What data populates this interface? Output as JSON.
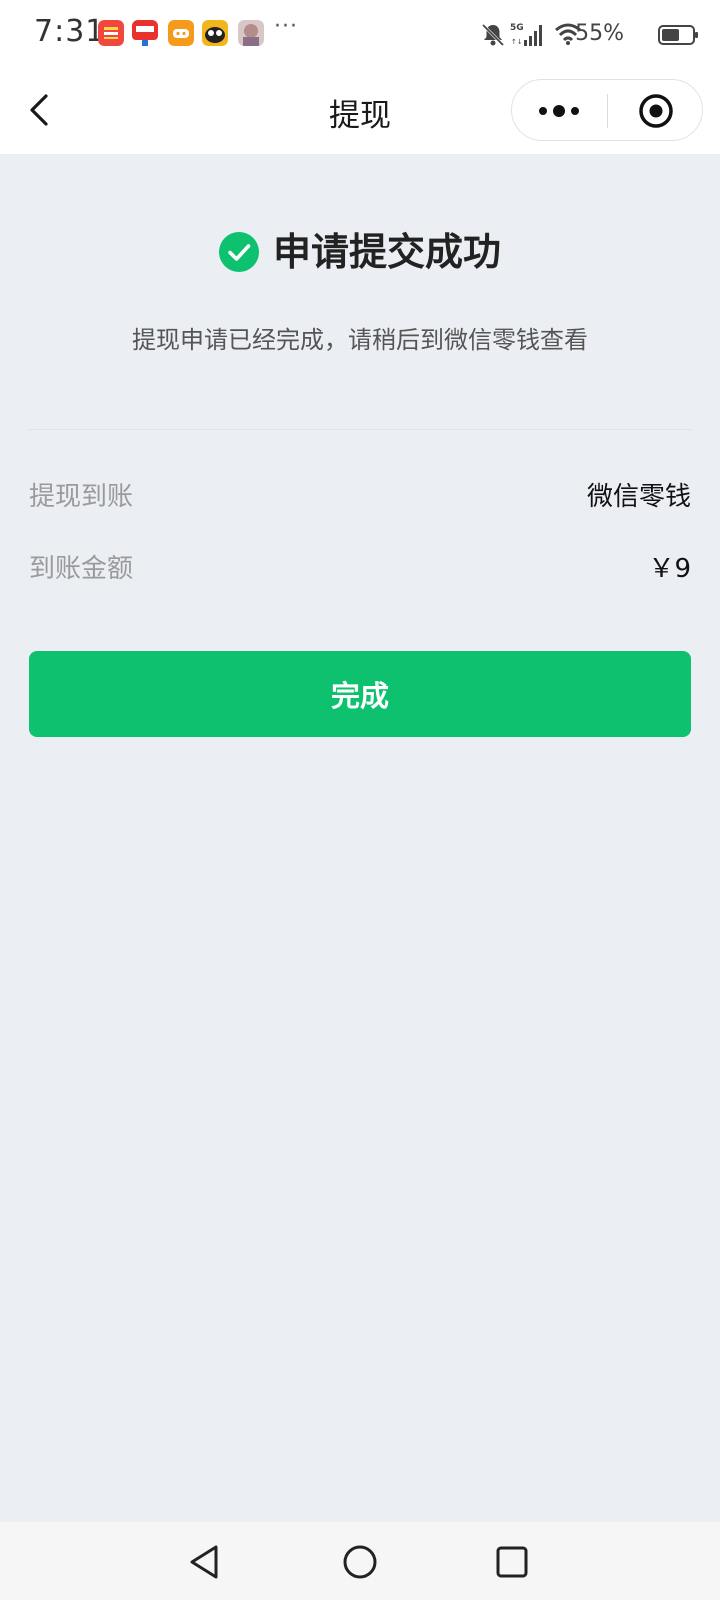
{
  "status_bar": {
    "time": "7:31",
    "notification_icons": [
      {
        "name": "news-app-icon",
        "color": "#f0473f"
      },
      {
        "name": "shopping-app-icon",
        "color": "#e8322e"
      },
      {
        "name": "game-controller-icon",
        "color": "#f59a1b"
      },
      {
        "name": "cartoon-app-icon",
        "color": "#f2b51c"
      },
      {
        "name": "anime-avatar-icon",
        "color": "#b58c8c"
      }
    ],
    "more_notifications": "···",
    "battery_percent": "55%"
  },
  "nav": {
    "title": "提现"
  },
  "result": {
    "title": "申请提交成功",
    "description": "提现申请已经完成，请稍后到微信零钱查看"
  },
  "details": [
    {
      "label": "提现到账",
      "value": "微信零钱"
    },
    {
      "label": "到账金额",
      "value": "￥9"
    }
  ],
  "done_button": {
    "label": "完成"
  },
  "colors": {
    "accent_green": "#0dc16f",
    "background": "#ebeef3"
  }
}
